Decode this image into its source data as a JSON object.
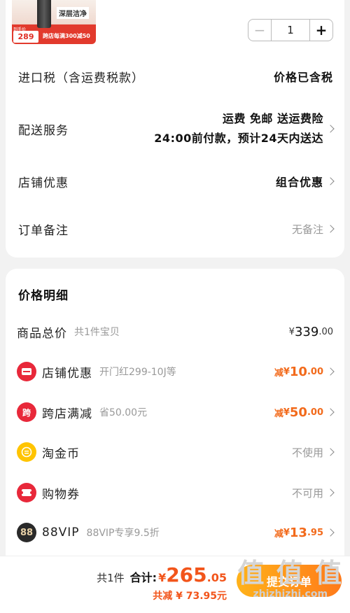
{
  "product": {
    "badge": "深层洁净",
    "hook": "",
    "price_label": "到手价",
    "price": "289",
    "promo": "跨店每满300减50",
    "quantity": "1",
    "minus": "−",
    "plus": "+"
  },
  "order": {
    "import_tax": {
      "label": "进口税（含运费税款）",
      "value": "价格已含税"
    },
    "shipping": {
      "label": "配送服务",
      "line1": "运费 免邮 送运费险",
      "line2": "24:00前付款，预计24天内送达"
    },
    "store_discount": {
      "label": "店铺优惠",
      "value": "组合优惠"
    },
    "note": {
      "label": "订单备注",
      "value": "无备注"
    }
  },
  "price_details": {
    "title": "价格明细",
    "rows": [
      {
        "title": "商品总价",
        "sub": "共1件宝贝",
        "prefix": "",
        "currency": "¥",
        "int": "339",
        "dec": ".00",
        "type": "total"
      },
      {
        "title": "店铺优惠",
        "sub": "开门红299-10J等",
        "prefix": "减",
        "currency": "¥",
        "int": "10",
        "dec": ".00",
        "type": "discount",
        "icon": "store-coupon-icon",
        "color": "#e8283a"
      },
      {
        "title": "跨店满减",
        "sub": "省50.00元",
        "prefix": "减",
        "currency": "¥",
        "int": "50",
        "dec": ".00",
        "type": "discount",
        "icon_text": "跨",
        "icon": "cross-store-icon",
        "color": "#e8283a"
      },
      {
        "title": "淘金币",
        "sub": "",
        "value": "不使用",
        "type": "muted",
        "icon": "gold-coin-icon",
        "color": "#ffc400"
      },
      {
        "title": "购物券",
        "sub": "",
        "value": "不可用",
        "type": "muted",
        "icon": "shopping-voucher-icon",
        "color": "#e8283a"
      },
      {
        "title": "88VIP",
        "sub": "88VIP专享9.5折",
        "prefix": "减",
        "currency": "¥",
        "int": "13",
        "dec": ".95",
        "type": "discount",
        "icon_text": "88",
        "icon": "vip88-icon",
        "color": "#2a2a2a"
      }
    ]
  },
  "footer": {
    "count": "共1件",
    "total_label": "合计:",
    "currency": "¥",
    "total_int": "265",
    "total_dec": ".05",
    "saved": "共减 ¥ 73.95元",
    "submit": "提交订单"
  },
  "watermark": {
    "logo": "值 值 值",
    "url": "zhizhizhi.com"
  }
}
